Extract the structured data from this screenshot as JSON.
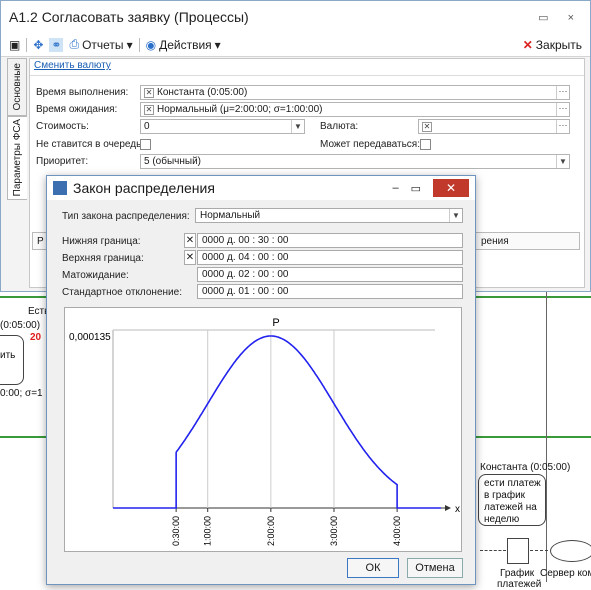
{
  "window": {
    "title": "А1.2 Согласовать заявку  (Процессы)",
    "controls": "▭ ×",
    "toolbar": {
      "reports": "Отчеты",
      "actions": "Действия",
      "close": "Закрыть"
    },
    "tabs": [
      "Основные",
      "Параметры ФСА"
    ],
    "change_currency": "Сменить валюту",
    "fields": {
      "exec_time_label": "Время выполнения:",
      "exec_time_value": "Константа (0:05:00)",
      "wait_time_label": "Время ожидания:",
      "wait_time_value": "Нормальный (μ=2:00:00; σ=1:00:00)",
      "cost_label": "Стоимость:",
      "cost_value": "0",
      "currency_label": "Валюта:",
      "no_queue_label": "Не ставится в очередь:",
      "transferable_label": "Может передаваться:",
      "priority_label": "Приоритет:",
      "priority_value": "5 (обычный)"
    },
    "table_header_fragment": "рения",
    "table_row_fragment": "Р"
  },
  "background": {
    "texts": [
      "Есть",
      "(0:05:00)",
      "20",
      "ить",
      "0:00; σ=1",
      "Константа (0:05:00)",
      "ести платеж",
      "в график",
      "латежей на",
      "неделю",
      "График",
      "платежей",
      "Сервер ком"
    ]
  },
  "dialog": {
    "title": "Закон распределения",
    "dist_type_label": "Тип закона распределения:",
    "dist_type_value": "Нормальный",
    "lower_label": "Нижняя граница:",
    "lower_value": "0000 д.  00 : 30 : 00",
    "upper_label": "Верхняя граница:",
    "upper_value": "0000 д.  04 : 00 : 00",
    "mean_label": "Матожидание:",
    "mean_value": "0000 д.  02 : 00 : 00",
    "std_label": "Стандартное отклонение:",
    "std_value": "0000 д.  01 : 00 : 00",
    "ok": "ОК",
    "cancel": "Отмена"
  },
  "chart_data": {
    "type": "line",
    "title": "P",
    "xlabel": "x",
    "ylabel": "",
    "ytick_label": "0,000135",
    "x_ticks": [
      "0:30:00",
      "1:00:00",
      "2:00:00",
      "3:00:00",
      "4:00:00"
    ],
    "x_tick_values_hours": [
      0.5,
      1,
      2,
      3,
      4
    ],
    "xlim_hours": [
      -0.5,
      4.6
    ],
    "ylim": [
      0,
      0.000135
    ],
    "distribution": {
      "kind": "truncated-normal",
      "mean_hours": 2,
      "std_hours": 1,
      "lower_hours": 0.5,
      "upper_hours": 4
    },
    "series_color": "#2222ee",
    "grid": true
  }
}
